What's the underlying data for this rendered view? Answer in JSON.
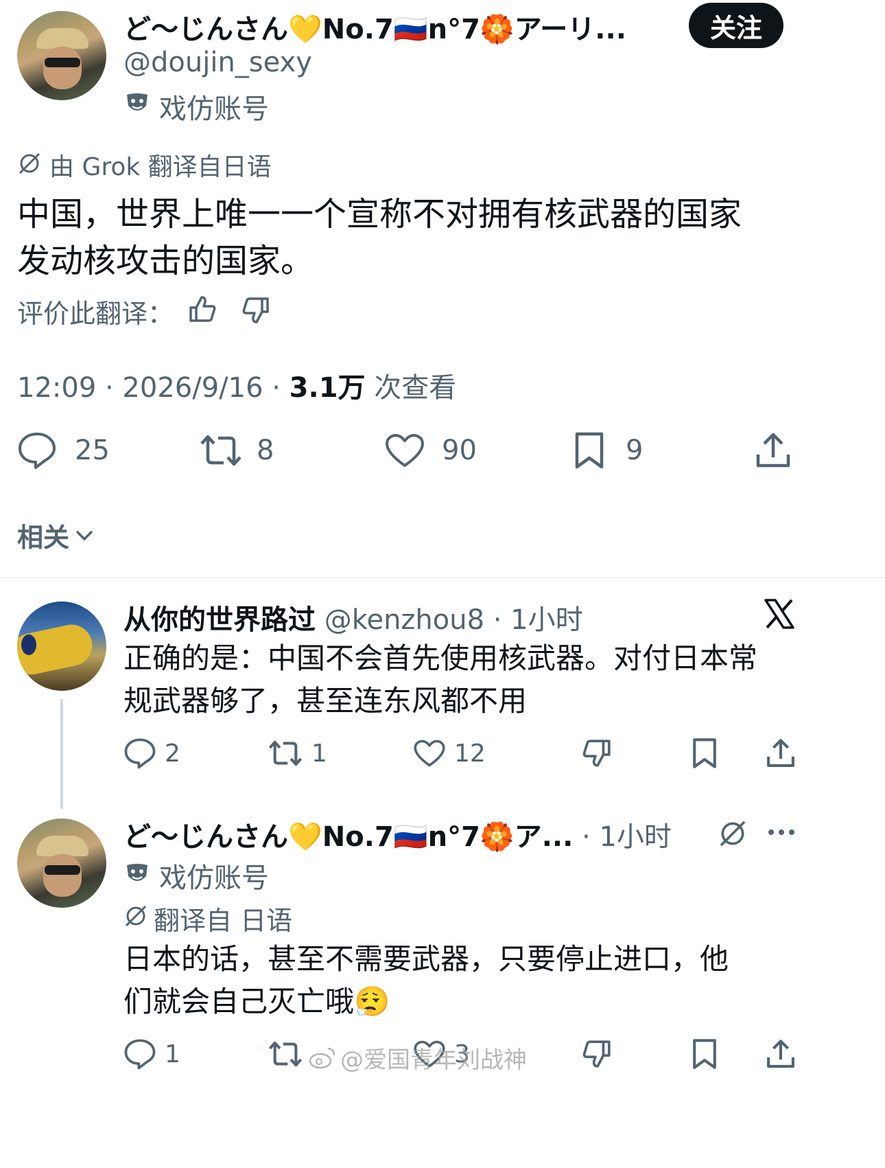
{
  "main_tweet": {
    "display_name": "ど〜じんさん💛No.7🇷🇺n°7🏵️アーリ...",
    "handle": "@doujin_sexy",
    "parody_label": "戏仿账号",
    "follow_label": "关注",
    "translation_note": "由 Grok 翻译自日语",
    "text": "中国，世界上唯一一个宣称不对拥有核武器的国家发动核攻击的国家。",
    "text_line1": "中国，世界上唯一一个宣称不对拥有核武器的国家",
    "text_line2": "发动核攻击的国家。",
    "rate_label": "评价此翻译：",
    "time": "12:09 · 2026/9/16 · ",
    "views_count": "3.1万",
    "views_label": " 次查看",
    "stats": {
      "replies": "25",
      "retweets": "8",
      "likes": "90",
      "bookmarks": "9"
    }
  },
  "related": {
    "label": "相关"
  },
  "reply1": {
    "display_name": "从你的世界路过",
    "handle_time": "@kenzhou8 · 1小时",
    "text_line1": "正确的是：中国不会首先使用核武器。对付日本常",
    "text_line2": "规武器够了，甚至连东风都不用",
    "stats": {
      "replies": "2",
      "retweets": "1",
      "likes": "12"
    }
  },
  "reply2": {
    "display_name": "ど〜じんさん💛No.7🇷🇺n°7🏵️ア...",
    "time": "· 1小时",
    "parody_label": "戏仿账号",
    "translation_note": "翻译自 日语",
    "text_line1": "日本的话，甚至不需要武器，只要停止进口，他",
    "text_line2": "们就会自己灭亡哦😮‍💨",
    "stats": {
      "replies": "1",
      "retweets": "",
      "likes": "3"
    }
  },
  "watermark": "@爱国青年刘战神",
  "colors": {
    "text": "#0f1419",
    "muted": "#536471",
    "button": "#0f1419",
    "divider": "#eff3f4"
  }
}
